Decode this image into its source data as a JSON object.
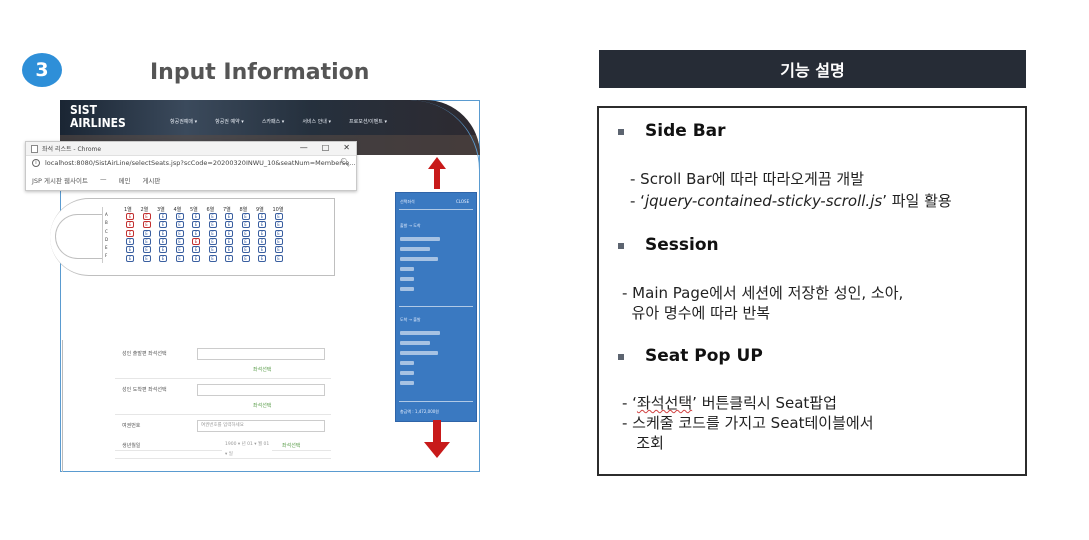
{
  "step": {
    "number": "3",
    "title": "Input Information"
  },
  "site": {
    "brand_line1": "SIST",
    "brand_line2": "AIRLINES",
    "nav": [
      "항공권예매 ▾",
      "항공권 예약 ▾",
      "스카패스 ▾",
      "서비스 안내 ▾",
      "프로모션/이벤트 ▾"
    ]
  },
  "browser": {
    "title": "좌석 리스트 - Chrome",
    "minimize": "—",
    "maximize": "□",
    "close": "✕",
    "url": "localhost:8080/SistAirLine/selectSeats.jsp?scCode=20200320INWU_10&seatNum=Memberse...",
    "bookmarks": [
      "JSP 게시판 웹사이트",
      "—",
      "메인",
      "게시판"
    ]
  },
  "seatmap": {
    "rows": [
      "1열",
      "2열",
      "3열",
      "4열",
      "5열",
      "6열",
      "7열",
      "8열",
      "9열",
      "10열"
    ],
    "letters": [
      "A",
      "B",
      "C",
      "D",
      "E",
      "F"
    ]
  },
  "form": {
    "rows": [
      {
        "label": "성인 출발편 좌석선택",
        "placeholder": "",
        "action": "좌석선택"
      },
      {
        "label": "성인 도착편 좌석선택",
        "placeholder": "",
        "action": "좌석선택"
      },
      {
        "label": "여권번호",
        "placeholder": "여권번호를 입력하세요",
        "action": ""
      },
      {
        "label": "생년월일",
        "placeholder": "1900 ▾ 년 01 ▾ 월 01 ▾ 일",
        "action": "좌석선택"
      }
    ]
  },
  "sidebar": {
    "top_label": "선택좌석",
    "top_right": "CLOSE",
    "section1": "출발 → 도착",
    "section2": "도착 → 출발",
    "footer": "총금액 : 1,472,000원"
  },
  "panel": {
    "header": "기능 설명",
    "items": [
      {
        "title": "Side Bar",
        "lines": [
          "- Scroll Bar에 따라 따라오게끔 개발"
        ],
        "file_prefix": "- ‘",
        "file_name": "jquery-contained-sticky-scroll.js",
        "file_suffix": "’ 파일  활용"
      },
      {
        "title": "Session",
        "lines": [
          "- Main Page에서 세션에 저장한 성인, 소아,",
          "  유아 명수에 따라 반복"
        ]
      },
      {
        "title": "Seat Pop UP",
        "btn_prefix": "- ‘",
        "btn_name": "좌석선택",
        "btn_suffix": "’ 버튼클릭시 Seat팝업",
        "lines": [
          "- 스케줄 코드를 가지고 Seat테이블에서",
          "   조회"
        ]
      }
    ]
  },
  "colors": {
    "badge": "#2e8fd8",
    "header_bg": "#262c36",
    "sidebar_bg": "#3a79c1",
    "arrow": "#c81a1a"
  }
}
